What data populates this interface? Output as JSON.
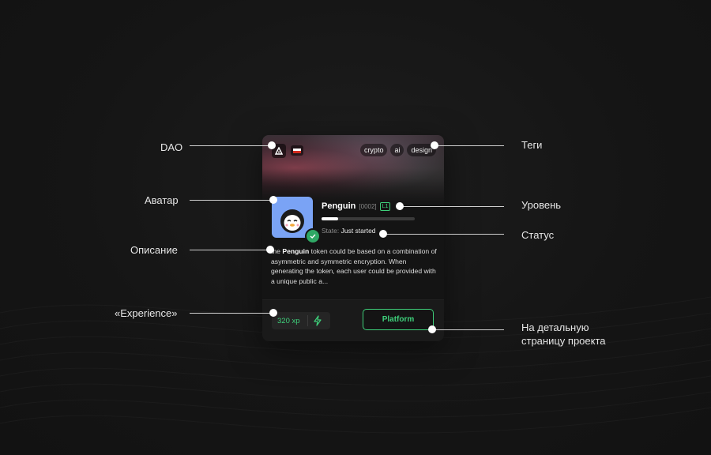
{
  "annotations": {
    "dao": "DAO",
    "avatar": "Аватар",
    "description": "Описание",
    "experience": "«Experience»",
    "tags": "Теги",
    "level": "Уровень",
    "status": "Статус",
    "detail_line1": "На детальную",
    "detail_line2": "страницу проекта"
  },
  "card": {
    "dao_icon": "dao-logo-icon",
    "flag_icon": "flag-icon",
    "tags": [
      "crypto",
      "ai",
      "design"
    ],
    "name": "Penguin",
    "code": "[0002]",
    "level": "L1",
    "progress": 0.18,
    "state_label": "State:",
    "state_value": "Just started",
    "description_bold": "Penguin",
    "description_prefix": "the ",
    "description_rest": " token could be based on a combination of asymmetric and symmetric encryption. When generating the token, each user could be provided with a unique public a...",
    "xp": "320 xp",
    "xp_icon": "lightning-icon",
    "verified_icon": "check-icon",
    "platform_button": "Platform"
  },
  "colors": {
    "background": "#151515",
    "accent": "#3ecf7a",
    "avatar_bg": "#7aa3f5"
  }
}
